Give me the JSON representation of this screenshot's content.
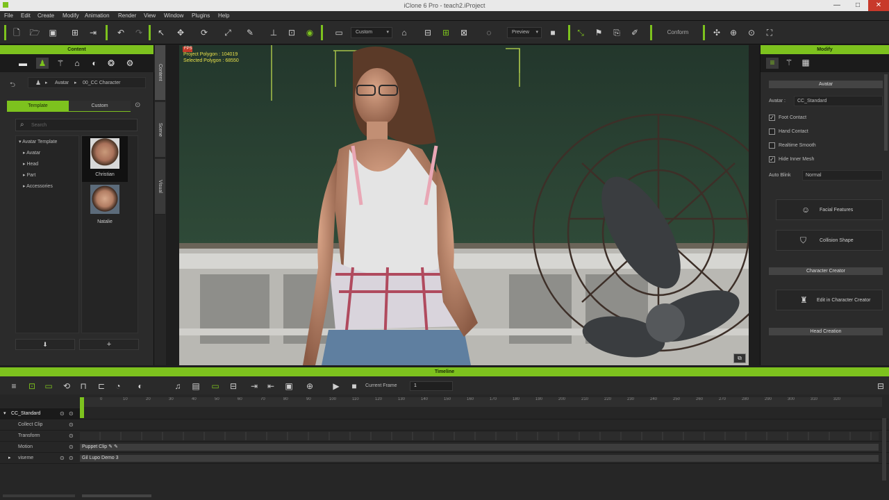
{
  "window": {
    "title": "iClone 6 Pro - teach2.iProject",
    "minimize": "—",
    "maximize": "□",
    "close": "✕"
  },
  "menu": [
    "File",
    "Edit",
    "Create",
    "Modify",
    "Animation",
    "Render",
    "View",
    "Window",
    "Plugins",
    "Help"
  ],
  "toolbar": {
    "camera_select": "Custom",
    "render_mode": "Preview",
    "conform_label": "Conform"
  },
  "content": {
    "title": "Content",
    "breadcrumb": [
      "Avatar",
      "00_CC Character"
    ],
    "tabs": [
      "Template",
      "Custom"
    ],
    "search_placeholder": "Search",
    "tree": [
      {
        "label": "Avatar Template",
        "expanded": true
      },
      {
        "label": "Avatar"
      },
      {
        "label": "Head"
      },
      {
        "label": "Part"
      },
      {
        "label": "Accessories"
      }
    ],
    "thumbs": [
      "Christian",
      "Natalie"
    ],
    "bottom_buttons": [
      "⬇",
      "+"
    ]
  },
  "vtabs": [
    "Content",
    "Scene",
    "Visual"
  ],
  "viewport": {
    "stats_line1": "Project Polygon : 104019",
    "stats_line2": "Selected Polygon : 68550",
    "fps": "FPS"
  },
  "modify": {
    "title": "Modify",
    "section_avatar": "Avatar",
    "avatar_label": "Avatar :",
    "avatar_value": "CC_Standard",
    "checks": [
      {
        "label": "Foot Contact",
        "checked": true
      },
      {
        "label": "Hand Contact",
        "checked": false
      },
      {
        "label": "Realtime Smooth",
        "checked": false
      },
      {
        "label": "Hide Inner Mesh",
        "checked": true
      }
    ],
    "autoblink_label": "Auto Blink",
    "autoblink_value": "Normal",
    "facial_features": "Facial Features",
    "collision_shape": "Collision Shape",
    "section_cc": "Character Creator",
    "edit_cc": "Edit in Character Creator",
    "section_hc": "Head Creation"
  },
  "timeline": {
    "title": "Timeline",
    "current_frame_label": "Current Frame",
    "current_frame_value": "1",
    "ruler": [
      "0",
      "10",
      "20",
      "30",
      "40",
      "50",
      "60",
      "70",
      "80",
      "90",
      "100",
      "110",
      "120",
      "130",
      "140",
      "150",
      "160",
      "170",
      "180",
      "190",
      "200",
      "210",
      "220",
      "230",
      "240",
      "250",
      "260",
      "270",
      "280",
      "290",
      "300",
      "310",
      "320"
    ],
    "rows": [
      {
        "label": "CC_Standard",
        "track": ""
      },
      {
        "label": "Collect Clip",
        "track": ""
      },
      {
        "label": "Transform",
        "track": ""
      },
      {
        "label": "Motion",
        "track": "Puppet Clip"
      },
      {
        "label": "viseme",
        "track": "Gil Lupo Demo 3"
      }
    ]
  },
  "colors": {
    "accent": "#7dc21e",
    "panel": "#2b2b2b",
    "dark": "#1e1e1e"
  }
}
